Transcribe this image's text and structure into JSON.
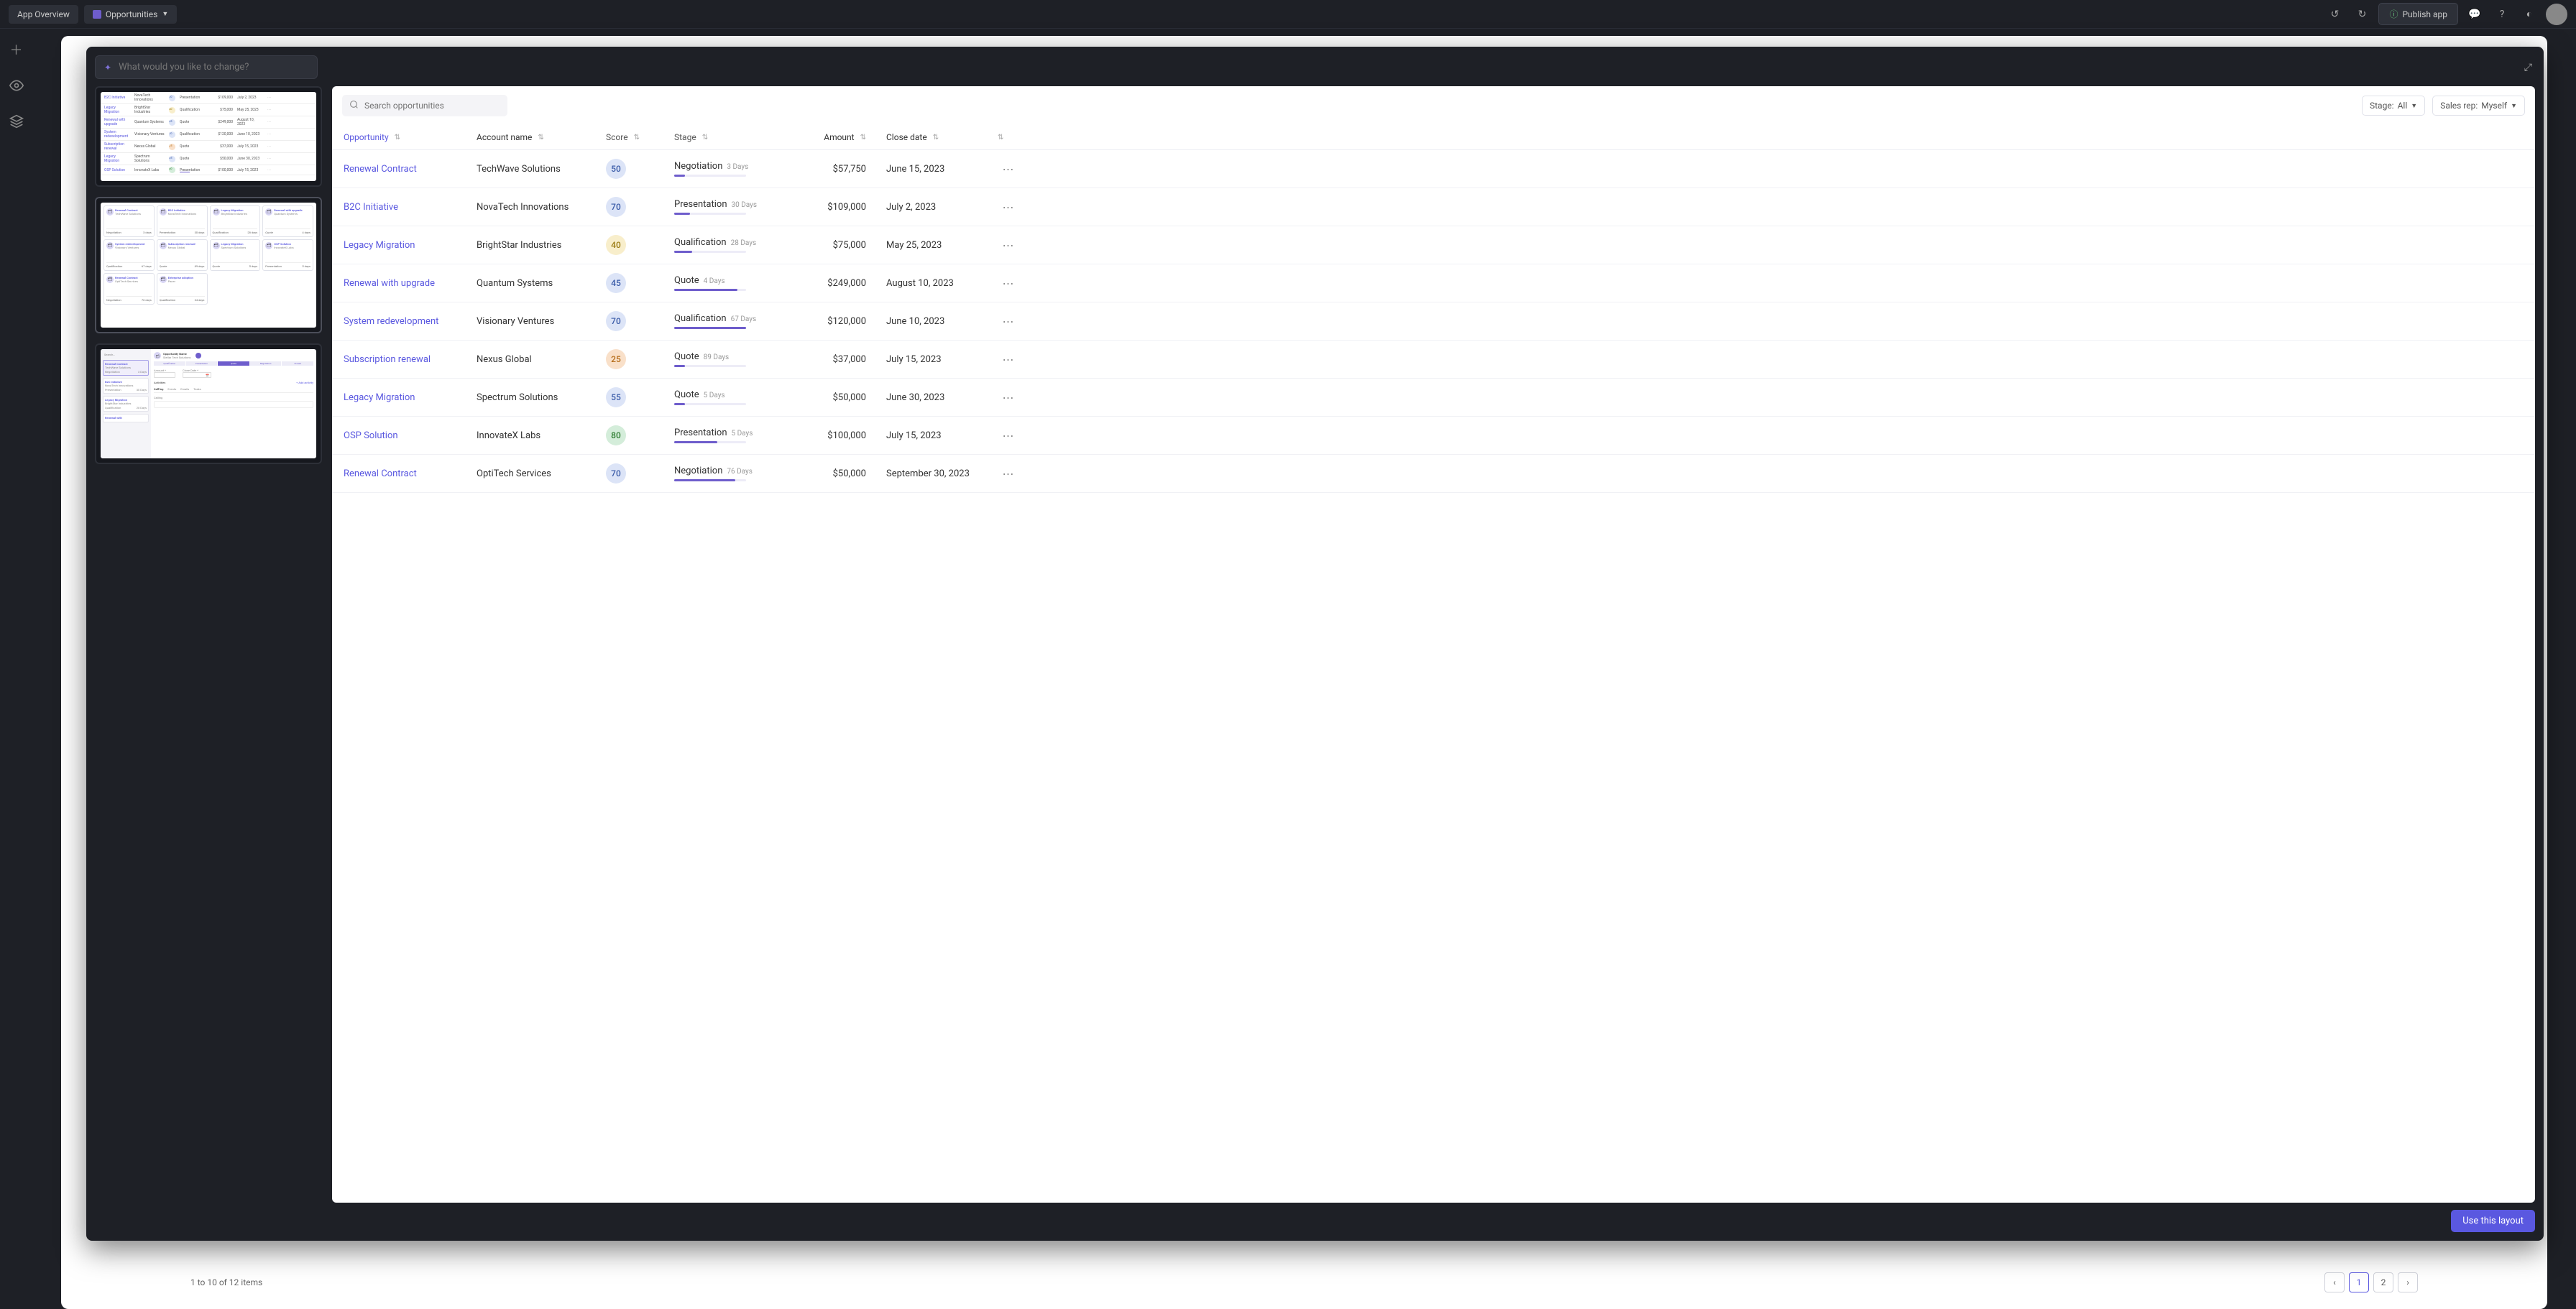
{
  "topbar": {
    "appOverview": "App Overview",
    "currentTab": "Opportunities",
    "publish": "Publish app"
  },
  "modal": {
    "prompt_placeholder": "What would you like to change?",
    "useLayout": "Use this layout"
  },
  "filters": {
    "search_placeholder": "Search opportunities",
    "stage_label": "Stage:",
    "stage_value": "All",
    "rep_label": "Sales rep:",
    "rep_value": "Myself"
  },
  "columns": {
    "opp": "Opportunity",
    "acc": "Account name",
    "score": "Score",
    "stage": "Stage",
    "amt": "Amount",
    "date": "Close date"
  },
  "rows": [
    {
      "opp": "Renewal Contract",
      "acc": "TechWave Solutions",
      "score": "50",
      "sc": "sc-blue",
      "stage": "Negotiation",
      "days": "3 Days",
      "pct": 15,
      "amt": "$57,750",
      "date": "June 15, 2023"
    },
    {
      "opp": "B2C Initiative",
      "acc": "NovaTech Innovations",
      "score": "70",
      "sc": "sc-blue",
      "stage": "Presentation",
      "days": "30 Days",
      "pct": 22,
      "amt": "$109,000",
      "date": "July 2, 2023"
    },
    {
      "opp": "Legacy Migration",
      "acc": "BrightStar Industries",
      "score": "40",
      "sc": "sc-yellow",
      "stage": "Qualification",
      "days": "28 Days",
      "pct": 25,
      "amt": "$75,000",
      "date": "May 25, 2023"
    },
    {
      "opp": "Renewal with upgrade",
      "acc": "Quantum Systems",
      "score": "45",
      "sc": "sc-blue",
      "stage": "Quote",
      "days": "4 Days",
      "pct": 88,
      "amt": "$249,000",
      "date": "August 10, 2023"
    },
    {
      "opp": "System redevelopment",
      "acc": "Visionary Ventures",
      "score": "70",
      "sc": "sc-blue",
      "stage": "Qualification",
      "days": "67 Days",
      "pct": 100,
      "amt": "$120,000",
      "date": "June 10, 2023"
    },
    {
      "opp": "Subscription renewal",
      "acc": "Nexus Global",
      "score": "25",
      "sc": "sc-orange",
      "stage": "Quote",
      "days": "89 Days",
      "pct": 15,
      "amt": "$37,000",
      "date": "July 15, 2023"
    },
    {
      "opp": "Legacy Migration",
      "acc": "Spectrum Solutions",
      "score": "55",
      "sc": "sc-blue",
      "stage": "Quote",
      "days": "5 Days",
      "pct": 15,
      "amt": "$50,000",
      "date": "June 30, 2023"
    },
    {
      "opp": "OSP Solution",
      "acc": "InnovateX Labs",
      "score": "80",
      "sc": "sc-green",
      "stage": "Presentation",
      "days": "5 Days",
      "pct": 60,
      "amt": "$100,000",
      "date": "July 15, 2023"
    },
    {
      "opp": "Renewal Contract",
      "acc": "OptiTech Services",
      "score": "70",
      "sc": "sc-blue",
      "stage": "Negotiation",
      "days": "76 Days",
      "pct": 85,
      "amt": "$50,000",
      "date": "September 30, 2023"
    }
  ],
  "pagination": {
    "text": "1 to 10 of 12 items",
    "pages": [
      "1",
      "2"
    ]
  },
  "thumb1_rows": [
    {
      "o": "B2C Initiative",
      "a": "NovaTech Innovations",
      "sc": "sc-blue",
      "s": "70",
      "st": "Presentation",
      "am": "$109,000",
      "d": "July 2, 2023"
    },
    {
      "o": "Legacy Migration",
      "a": "BrightStar Industries",
      "sc": "sc-yellow",
      "s": "40",
      "st": "Qualification",
      "am": "$75,000",
      "d": "May 25, 2023"
    },
    {
      "o": "Renewal with upgrade",
      "a": "Quantum Systems",
      "sc": "sc-blue",
      "s": "45",
      "st": "Quote",
      "am": "$249,000",
      "d": "August 10, 2023"
    },
    {
      "o": "System redevelopment",
      "a": "Visionary Ventures",
      "sc": "sc-blue",
      "s": "70",
      "st": "Qualification",
      "am": "$120,000",
      "d": "June 10, 2023"
    },
    {
      "o": "Subscription renewal",
      "a": "Nexus Global",
      "sc": "sc-orange",
      "s": "25",
      "st": "Quote",
      "am": "$37,000",
      "d": "July 15, 2023"
    },
    {
      "o": "Legacy Migration",
      "a": "Spectrum Solutions",
      "sc": "sc-blue",
      "s": "55",
      "st": "Quote",
      "am": "$50,000",
      "d": "June 30, 2023"
    },
    {
      "o": "OSP Solution",
      "a": "InnovateX Labs",
      "sc": "sc-green",
      "s": "80",
      "st": "Presentation",
      "am": "$100,000",
      "d": "July 15, 2023"
    }
  ],
  "thumb2_cards": [
    {
      "t": "Renewal Contract",
      "s": "TechWave Solutions",
      "st": "Negotiation",
      "d": "3 days"
    },
    {
      "t": "B2C Initiative",
      "s": "NovaTech Innovations",
      "st": "Presentation",
      "d": "30 days"
    },
    {
      "t": "Legacy Migration",
      "s": "BrightStar Industries",
      "st": "Qualification",
      "d": "28 days"
    },
    {
      "t": "Renewal with upgrade",
      "s": "Quantum Systems",
      "st": "Quote",
      "d": "4 days"
    },
    {
      "t": "System redevelopment",
      "s": "Visionary Ventures",
      "st": "Qualification",
      "d": "67 days"
    },
    {
      "t": "Subscription renewal",
      "s": "Nexus Global",
      "st": "Quote",
      "d": "89 days"
    },
    {
      "t": "Legacy Migration",
      "s": "Spectrum Solutions",
      "st": "Quote",
      "d": "5 days"
    },
    {
      "t": "OSP Solution",
      "s": "InnovateX Labs",
      "st": "Presentation",
      "d": "5 days"
    },
    {
      "t": "Renewal Contract",
      "s": "OptiTech Services",
      "st": "Negotiation",
      "d": "76 days"
    },
    {
      "t": "Enterprise adoption",
      "s": "Pacer",
      "st": "Qualification",
      "d": "34 days"
    }
  ],
  "thumb3": {
    "side": [
      {
        "t": "Renewal Contract",
        "s": "TechWave Solutions",
        "st": "Negotiation",
        "d": "3 Days",
        "sel": true
      },
      {
        "t": "B2C Initiative",
        "s": "NovaTech Innovations",
        "st": "Presentation",
        "d": "30 Days"
      },
      {
        "t": "Legacy Migration",
        "s": "BrightStar Industries",
        "st": "Qualification",
        "d": "28 Days"
      },
      {
        "t": "Renewal with",
        "s": "",
        "st": "",
        "d": ""
      }
    ],
    "title": "Opportunity Name",
    "sub": "Stellar Tech Solutions",
    "steps": [
      "Qualification",
      "Presentation",
      "Quote",
      "Negotiation",
      "Closed"
    ],
    "fields": {
      "amt": "Amount *",
      "cd": "Close Date *"
    },
    "tabs": [
      "Call log",
      "Events",
      "Emails",
      "Tasks"
    ],
    "activities": "Activities",
    "addActivity": "+ Add activity",
    "calling": "Calling"
  }
}
